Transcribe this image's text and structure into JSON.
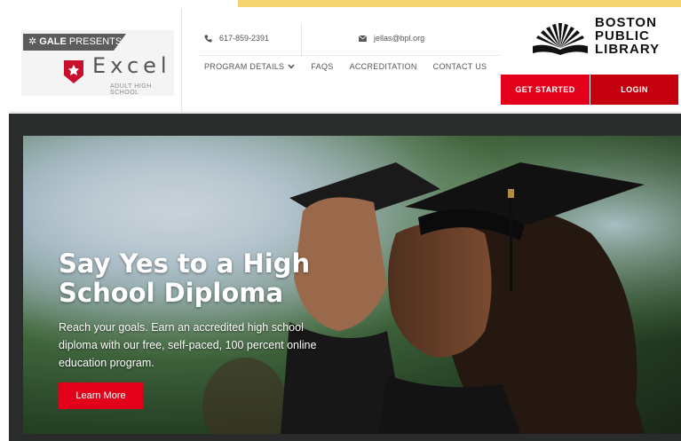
{
  "brand": {
    "gale_label": "GALE",
    "presents_label": "PRESENTS",
    "excel_word": "Excel",
    "excel_subtitle": "ADULT HIGH SCHOOL"
  },
  "contact": {
    "phone": "617-859-2391",
    "email": "jellas@bpl.org"
  },
  "nav": {
    "items": [
      {
        "label": "PROGRAM DETAILS",
        "has_dropdown": true
      },
      {
        "label": "FAQS"
      },
      {
        "label": "ACCREDITATION"
      },
      {
        "label": "CONTACT US"
      }
    ]
  },
  "partner": {
    "line1": "BOSTON",
    "line2": "PUBLIC",
    "line3": "LIBRARY"
  },
  "actions": {
    "get_started": "GET STARTED",
    "login": "LOGIN"
  },
  "hero": {
    "title_line1": "Say Yes to a High",
    "title_line2": "School Diploma",
    "description": "Reach your goals. Earn an accredited high school diploma with our free, self-paced, 100 percent online education program.",
    "cta": "Learn More"
  },
  "colors": {
    "accent_red": "#e2001a",
    "login_red": "#c4000f",
    "accent_yellow": "#f3d46e",
    "hero_frame": "#2a2c2c"
  },
  "icons": {
    "phone": "phone-icon",
    "email": "envelope-icon",
    "dropdown": "chevron-down-icon",
    "library": "sunburst-book-icon"
  }
}
